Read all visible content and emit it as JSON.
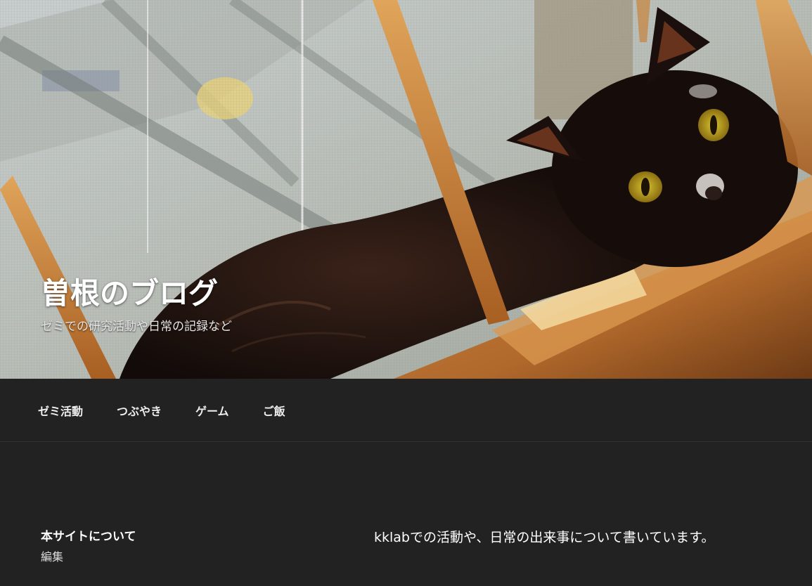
{
  "header": {
    "site_title": "曽根のブログ",
    "site_description": "ゼミでの研究活動や日常の記録など"
  },
  "nav": {
    "items": [
      {
        "label": "ゼミ活動"
      },
      {
        "label": "つぶやき"
      },
      {
        "label": "ゲーム"
      },
      {
        "label": "ご飯"
      }
    ]
  },
  "about": {
    "heading": "本サイトについて",
    "edit_label": "編集",
    "description": "kklabでの活動や、日常の出来事について書いています。"
  },
  "colors": {
    "background": "#222222",
    "text": "#ffffff",
    "nav_text": "#eeeeee"
  }
}
